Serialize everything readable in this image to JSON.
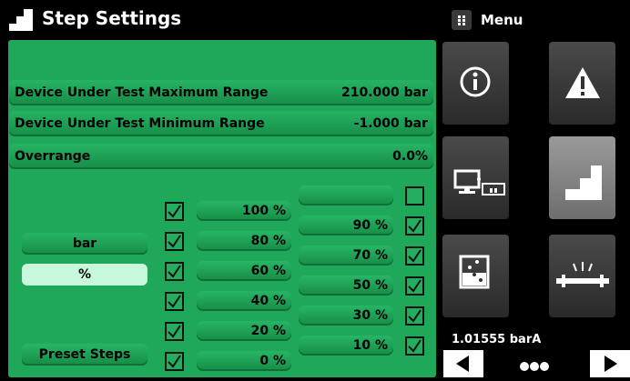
{
  "header": {
    "title": "Step Settings",
    "menu_label": "Menu"
  },
  "settings": {
    "max_range": {
      "label": "Device Under Test Maximum Range",
      "value": "210.000 bar"
    },
    "min_range": {
      "label": "Device Under Test Minimum Range",
      "value": "-1.000 bar"
    },
    "overrange": {
      "label": "Overrange",
      "value": "0.0%"
    }
  },
  "units": {
    "bar_label": "bar",
    "percent_label": "%",
    "preset_label": "Preset Steps"
  },
  "steps_left": [
    "100 %",
    "80 %",
    "60 %",
    "40 %",
    "20 %",
    "0 %"
  ],
  "steps_right": [
    "",
    "90 %",
    "70 %",
    "50 %",
    "30 %",
    "10 %"
  ],
  "checked_left": [
    true,
    true,
    true,
    true,
    true,
    true
  ],
  "checked_right": [
    false,
    true,
    true,
    true,
    true,
    true
  ],
  "status": {
    "pressure": "1.01555 barA"
  },
  "icons": [
    "step-icon",
    "menu-icon",
    "info-icon",
    "warning-icon",
    "remote-icon",
    "step-settings-icon",
    "leak-test-icon",
    "sensor-icon",
    "arrow-left-icon",
    "arrow-right-icon"
  ],
  "colors": {
    "panel": "#1fa85a",
    "selected": "#c8f8dc"
  }
}
